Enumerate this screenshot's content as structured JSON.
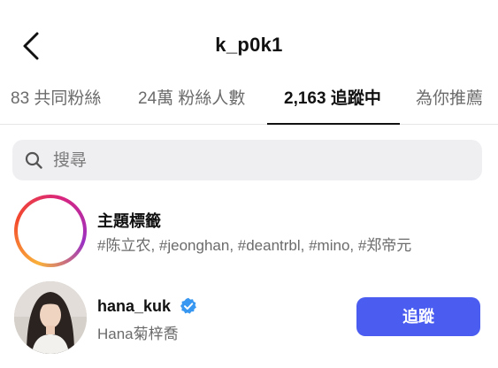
{
  "header": {
    "title": "k_p0k1",
    "back_icon": "chevron-left-icon"
  },
  "tabs": [
    {
      "label": "83 共同粉絲",
      "active": false
    },
    {
      "label": "24萬 粉絲人數",
      "active": false
    },
    {
      "label": "2,163 追蹤中",
      "active": true
    },
    {
      "label": "為你推薦",
      "active": false
    }
  ],
  "search": {
    "placeholder": "搜尋",
    "icon": "search-icon"
  },
  "hashtags": {
    "title": "主題標籤",
    "subtitle": "#陈立农, #jeonghan, #deantrbl, #mino, #郑帝元"
  },
  "users": [
    {
      "username": "hana_kuk",
      "full_name": "Hana菊梓喬",
      "verified": true,
      "follow_label": "追蹤"
    }
  ],
  "colors": {
    "accent": "#4b5cf0",
    "verified": "#3897f0",
    "active_tab": "#111111",
    "inactive_tab": "#6b6b6b"
  }
}
